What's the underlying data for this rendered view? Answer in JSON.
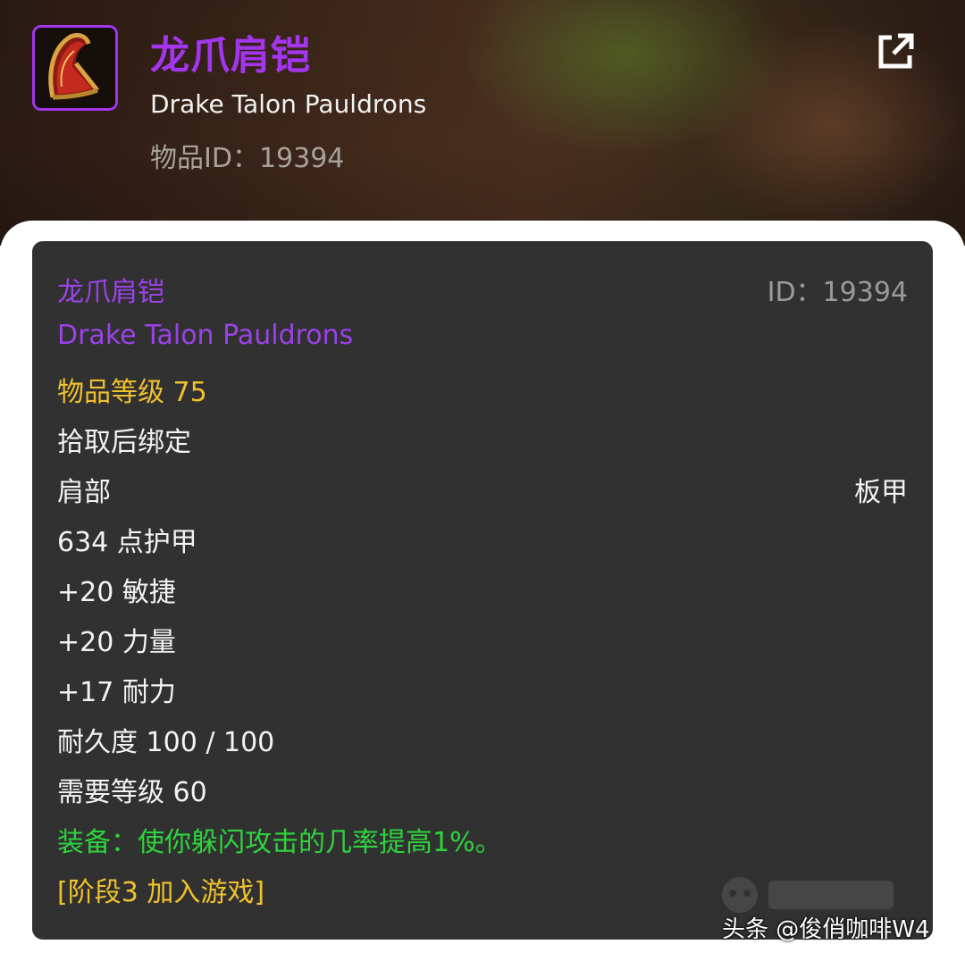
{
  "header": {
    "title_cn": "龙爪肩铠",
    "title_en": "Drake Talon Pauldrons",
    "item_id": "物品ID：19394",
    "icon": "pauldron-icon",
    "open_link_icon": "external-link-icon"
  },
  "tooltip": {
    "name_cn": "龙爪肩铠",
    "id_label": "ID：19394",
    "name_en": "Drake Talon Pauldrons",
    "item_level": "物品等级 75",
    "bind": "拾取后绑定",
    "slot": "肩部",
    "armor_type": "板甲",
    "armor": "634 点护甲",
    "stats": [
      "+20 敏捷",
      "+20 力量",
      "+17 耐力"
    ],
    "durability": "耐久度 100 / 100",
    "required_level": "需要等级 60",
    "equip_effect": "装备：使你躲闪攻击的几率提高1%。",
    "phase": "[阶段3 加入游戏]"
  },
  "watermark": {
    "credit": "头条 @俊俏咖啡W4"
  },
  "colors": {
    "epic_purple": "#a335ee",
    "item_level_gold": "#efc12d",
    "equip_green": "#2ed43c",
    "tooltip_bg": "#313131"
  }
}
